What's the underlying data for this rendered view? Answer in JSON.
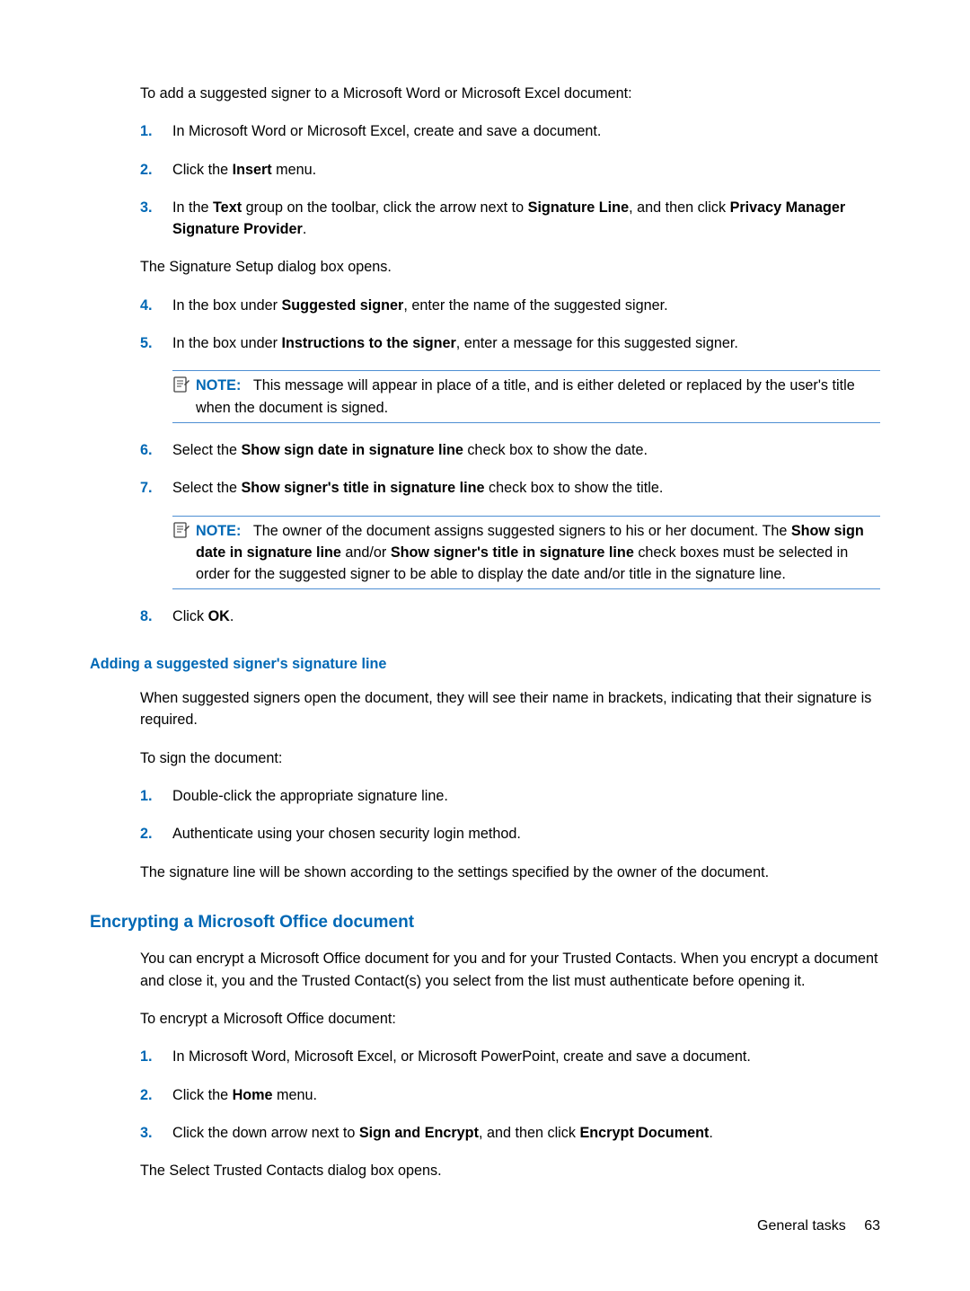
{
  "intro": {
    "p1": "To add a suggested signer to a Microsoft Word or Microsoft Excel document:"
  },
  "steps_a": {
    "s1_num": "1.",
    "s1_html": "In Microsoft Word or Microsoft Excel, create and save a document.",
    "s2_num": "2.",
    "s2_html": "Click the <b>Insert</b> menu.",
    "s3_num": "3.",
    "s3_html": "In the <b>Text</b> group on the toolbar, click the arrow next to <b>Signature Line</b>, and then click <b>Privacy Manager Signature Provider</b>.",
    "s3_sub": "The Signature Setup dialog box opens.",
    "s4_num": "4.",
    "s4_html": "In the box under <b>Suggested signer</b>, enter the name of the suggested signer.",
    "s5_num": "5.",
    "s5_html": "In the box under <b>Instructions to the signer</b>, enter a message for this suggested signer.",
    "note1_label": "NOTE:",
    "note1_text": "This message will appear in place of a title, and is either deleted or replaced by the user's title when the document is signed.",
    "s6_num": "6.",
    "s6_html": "Select the <b>Show sign date in signature line</b> check box to show the date.",
    "s7_num": "7.",
    "s7_html": "Select the <b>Show signer's title in signature line</b> check box to show the title.",
    "note2_label": "NOTE:",
    "note2_text": "The owner of the document assigns suggested signers to his or her document. The <b>Show sign date in signature line</b> and/or <b>Show signer's title in signature line</b> check boxes must be selected in order for the suggested signer to be able to display the date and/or title in the signature line.",
    "s8_num": "8.",
    "s8_html": "Click <b>OK</b>."
  },
  "sec_b": {
    "heading": "Adding a suggested signer's signature line",
    "p1": "When suggested signers open the document, they will see their name in brackets, indicating that their signature is required.",
    "p2": "To sign the document:",
    "s1_num": "1.",
    "s1_html": "Double-click the appropriate signature line.",
    "s2_num": "2.",
    "s2_html": "Authenticate using your chosen security login method.",
    "s2_sub": "The signature line will be shown according to the settings specified by the owner of the document."
  },
  "sec_c": {
    "heading": "Encrypting a Microsoft Office document",
    "p1": "You can encrypt a Microsoft Office document for you and for your Trusted Contacts. When you encrypt a document and close it, you and the Trusted Contact(s) you select from the list must authenticate before opening it.",
    "p2": "To encrypt a Microsoft Office document:",
    "s1_num": "1.",
    "s1_html": "In Microsoft Word, Microsoft Excel, or Microsoft PowerPoint, create and save a document.",
    "s2_num": "2.",
    "s2_html": "Click the <b>Home</b> menu.",
    "s3_num": "3.",
    "s3_html": "Click the down arrow next to <b>Sign and Encrypt</b>, and then click <b>Encrypt Document</b>.",
    "s3_sub": "The Select Trusted Contacts dialog box opens."
  },
  "footer": {
    "section": "General tasks",
    "page": "63"
  }
}
